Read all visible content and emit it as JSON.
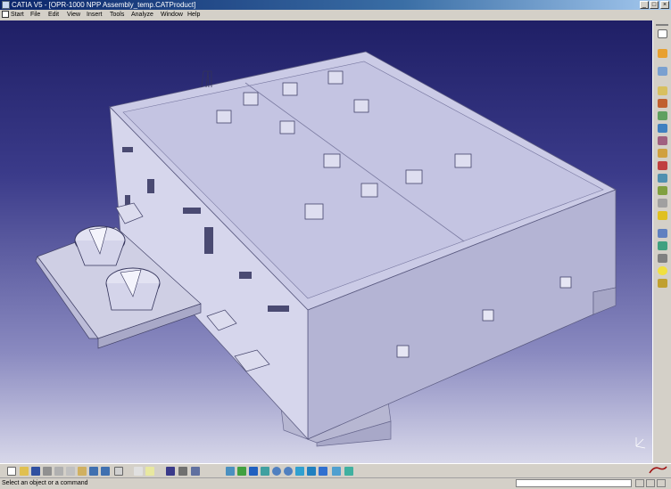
{
  "window": {
    "title": "CATIA V5 - [OPR-1000 NPP Assembly_temp.CATProduct]",
    "minimize_glyph": "_",
    "maximize_glyph": "□",
    "close_glyph": "×"
  },
  "menu": {
    "items": [
      "Start",
      "File",
      "Edit",
      "View",
      "Insert",
      "Tools",
      "Analyze",
      "Window",
      "Help"
    ]
  },
  "status": {
    "message": "Select an object or a command",
    "input_value": "",
    "input_placeholder": ""
  },
  "icons": {
    "app": "catia-app-icon",
    "right_toolbar": [
      "select-icon",
      "annotation-icon",
      "product-icon",
      "insert-component-icon",
      "fix-icon",
      "constraint-icon",
      "move-icon",
      "snap-icon",
      "explode-icon",
      "clash-icon",
      "section-icon",
      "distance-icon",
      "measure-icon",
      "catalog-icon",
      "scene-icon",
      "publish-icon",
      "bom-icon",
      "lamp-icon",
      "render-icon"
    ],
    "bottom_toolbar": [
      "new-icon",
      "open-icon",
      "save-icon",
      "print-icon",
      "cut-icon",
      "copy-icon",
      "paste-icon",
      "undo-icon",
      "redo-icon",
      "help-icon",
      "formula-icon",
      "comment-icon",
      "catalog-browser-icon",
      "material-icon",
      "apply-material-icon",
      "fly-mode-icon",
      "fit-all-icon",
      "pan-icon",
      "rotate-icon",
      "zoom-in-icon",
      "zoom-out-icon",
      "normal-view-icon",
      "iso-view-icon",
      "shading-icon",
      "hide-show-icon",
      "swap-space-icon"
    ],
    "compass": "compass-icon",
    "logo": "catia-logo"
  },
  "colors": {
    "titlebar_start": "#0a246a",
    "viewport_top": "#1f1f66",
    "viewport_bottom": "#d8d8ea",
    "building_roof": "#c8c8e8",
    "building_wall_front": "#cfcfe6",
    "building_wall_side": "#b8b8d6"
  }
}
